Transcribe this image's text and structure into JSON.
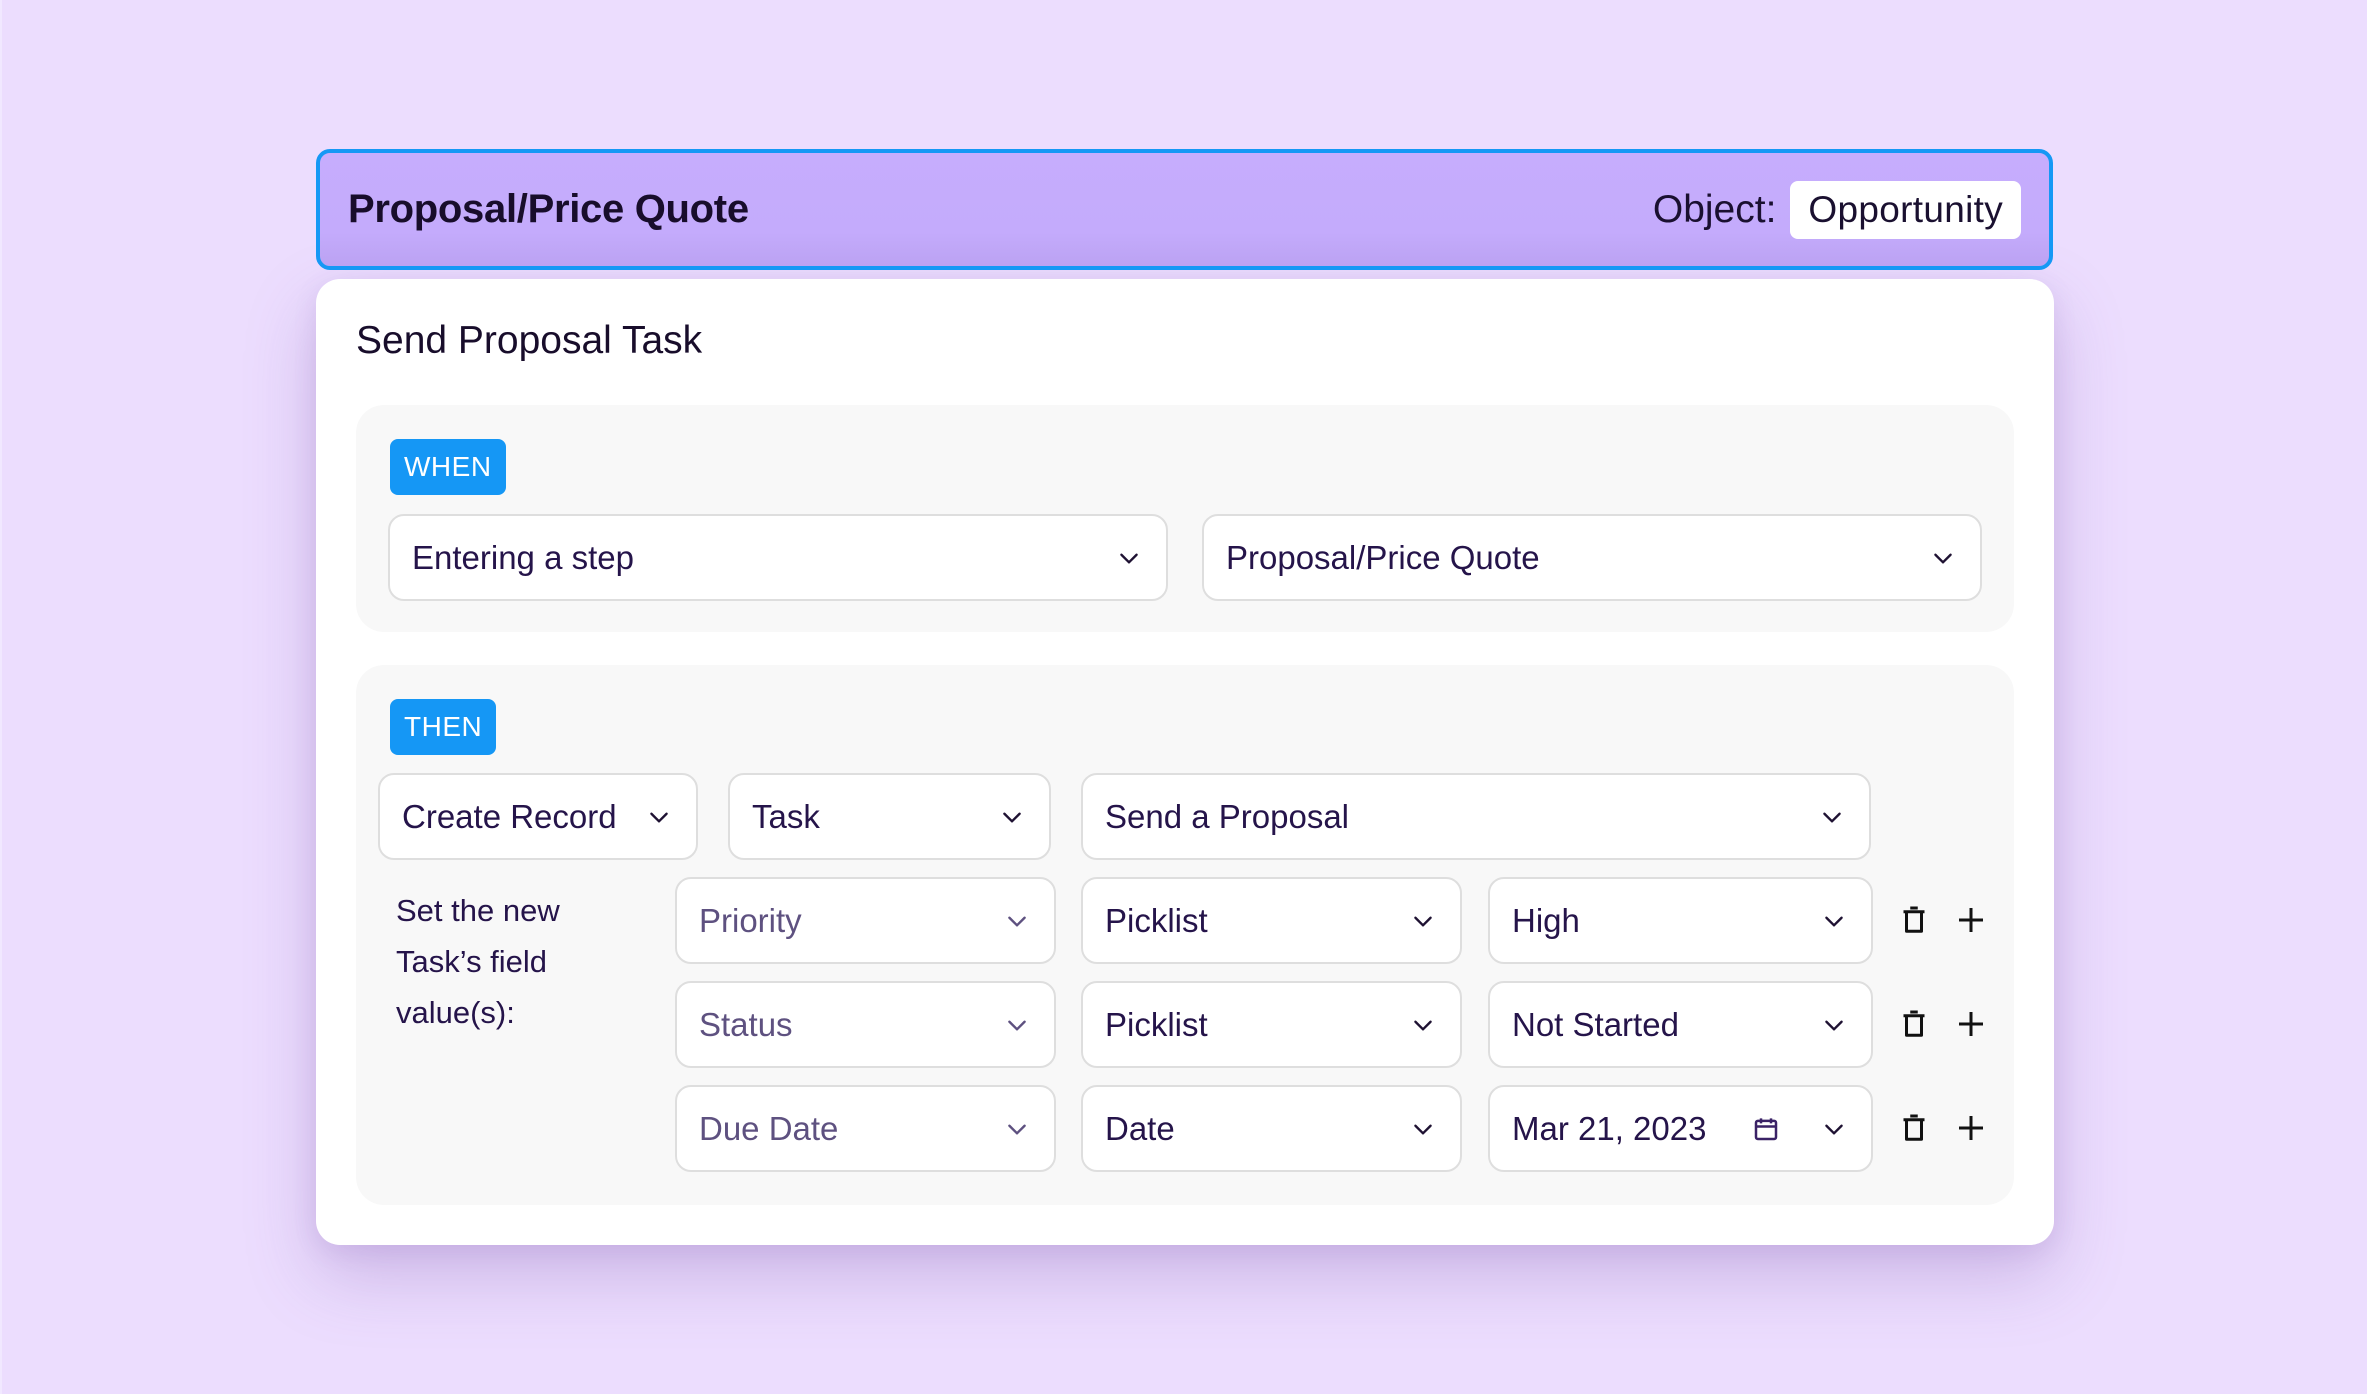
{
  "header": {
    "title": "Proposal/Price Quote",
    "object_label": "Object:",
    "object_value": "Opportunity"
  },
  "card": {
    "title": "Send Proposal Task",
    "when": {
      "badge": "WHEN",
      "trigger": "Entering a step",
      "stage": "Proposal/Price Quote"
    },
    "then": {
      "badge": "THEN",
      "action": "Create Record",
      "record_type": "Task",
      "template": "Send a Proposal",
      "fields_label": "Set the new Task’s field value(s):",
      "fields_label_lines": [
        "Set the new",
        "Task’s field",
        "value(s):"
      ],
      "rows": [
        {
          "field": "Priority",
          "type": "Picklist",
          "value": "High"
        },
        {
          "field": "Status",
          "type": "Picklist",
          "value": "Not Started"
        },
        {
          "field": "Due Date",
          "type": "Date",
          "value": "Mar 21, 2023"
        }
      ]
    }
  },
  "icons": {
    "chevron": "chevron-down-icon",
    "calendar": "calendar-icon",
    "delete": "trash-icon",
    "add": "plus-icon"
  },
  "colors": {
    "background": "#ecddfe",
    "header_fill": "#c5adfc",
    "accent_blue": "#1598f5",
    "text_dark": "#25144a",
    "panel_bg": "#f8f8f8"
  }
}
